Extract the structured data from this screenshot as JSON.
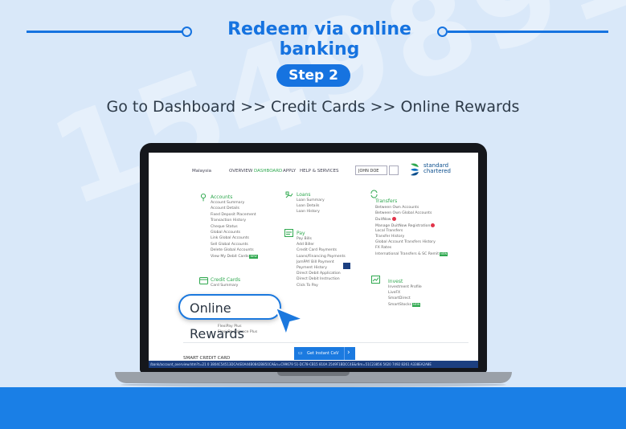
{
  "header": {
    "title": "Redeem via online banking",
    "step_label": "Step 2",
    "subtitle": "Go to Dashboard >> Credit Cards >> Online Rewards"
  },
  "watermark": "1549891",
  "colors": {
    "background": "#d9e8f9",
    "accent_blue": "#1673e0",
    "bank_green": "#2fa84f",
    "bottom_band": "#1a7fe6"
  },
  "screen": {
    "nav": {
      "country": "Malaysia",
      "overview": "OVERVIEW",
      "dashboard": "DASHBOARD",
      "apply": "APPLY",
      "help": "HELP & SERVICES",
      "user": "JOHN DOE",
      "bank_name_line1": "standard",
      "bank_name_line2": "chartered"
    },
    "accounts": {
      "heading": "Accounts",
      "items": [
        "Account Summary",
        "Account Details",
        "Fixed Deposit Placement",
        "Transaction History",
        "Cheque Status",
        "Global Accounts",
        "Link Global Accounts",
        "Sell Global Accounts",
        "Delete Global Accounts",
        "View My Debit Cards"
      ],
      "new_badge": "NEW"
    },
    "credit_cards": {
      "heading": "Credit Cards",
      "items": [
        "Card Summary"
      ],
      "lower_items": [
        "FlexiPay Plus",
        "Flexi On Balance Plus"
      ]
    },
    "loans": {
      "heading": "Loans",
      "items": [
        "Loan Summary",
        "Loan Details",
        "Loan History"
      ]
    },
    "pay": {
      "heading": "Pay",
      "items": [
        "Pay Bills",
        "Add Biller",
        "Credit Card Payments",
        "Loans/Financing Payments",
        "JomPAY Bill Payment",
        "Payment History",
        "Direct Debit Application",
        "Direct Debit Instruction",
        "Click To Pay"
      ]
    },
    "transfers": {
      "heading": "Transfers",
      "items": [
        "Between Own Accounts",
        "Between Own Global Accounts",
        "DuitNow",
        "Manage DuitNow Registration",
        "Local Transfers",
        "Transfer History",
        "Global Account Transfers History",
        "FX Rates",
        "International Transfers & SC Remit"
      ]
    },
    "invest": {
      "heading": "Invest",
      "items": [
        "Investment Profile",
        "LiveFX",
        "SmartDirect",
        "SmartStocks"
      ]
    },
    "smart_credit_card": "SMART CREDIT CARD",
    "instant_cta": "Get Instant CeV",
    "status_url": "/bank/account_overview.htm?t=21 0 3804C54513DCA4E0A44B0842B850CA&n=C99679 51-DC78-CB15 810A 2549F1BDCC4E&r8m=51C23856 5620 7492 8261 A338EA2A8E"
  },
  "callout": {
    "label": "Online Rewards"
  }
}
